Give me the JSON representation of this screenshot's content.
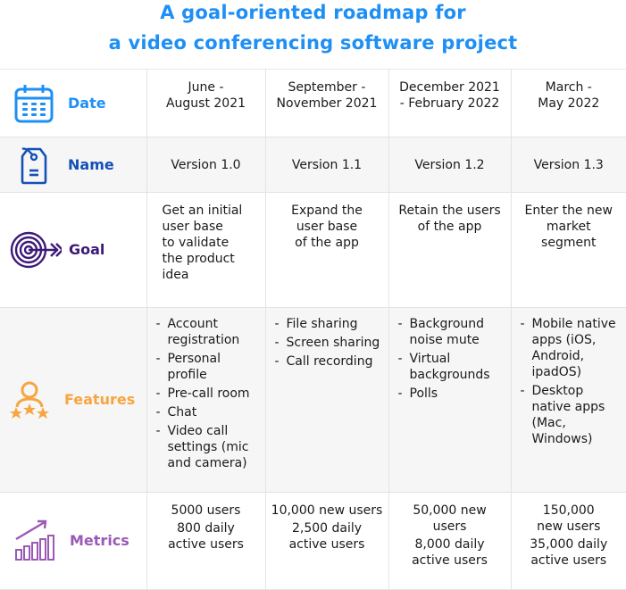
{
  "title": {
    "line1": "A goal-oriented roadmap for",
    "line2": "a video conferencing software project"
  },
  "colors": {
    "title": "#1e8ff5",
    "date": "#1e8ff5",
    "name": "#1450b8",
    "goal": "#3d1a78",
    "features": "#f7a541",
    "metrics": "#9b59b6"
  },
  "rows": {
    "date": {
      "label": "Date",
      "icon": "calendar-icon",
      "cells": [
        [
          "June -",
          "August 2021"
        ],
        [
          "September -",
          "November 2021"
        ],
        [
          "December 2021",
          "- February 2022"
        ],
        [
          "March -",
          "May 2022"
        ]
      ]
    },
    "name": {
      "label": "Name",
      "icon": "tag-icon",
      "cells": [
        "Version 1.0",
        "Version 1.1",
        "Version 1.2",
        "Version 1.3"
      ]
    },
    "goal": {
      "label": "Goal",
      "icon": "target-icon",
      "cells": [
        [
          "Get an initial",
          "user base",
          "to validate",
          "the product",
          "idea"
        ],
        [
          "Expand the",
          "user base",
          "of the app"
        ],
        [
          "Retain the users",
          "of the app"
        ],
        [
          "Enter the new",
          "market",
          "segment"
        ]
      ]
    },
    "features": {
      "label": "Features",
      "icon": "user-stars-icon",
      "cells": [
        [
          "Account registration",
          "Personal profile",
          "Pre-call room",
          "Chat",
          "Video call settings (mic and camera)"
        ],
        [
          "File sharing",
          "Screen sharing",
          "Call recording"
        ],
        [
          "Background noise mute",
          "Virtual backgrounds",
          "Polls"
        ],
        [
          "Mobile native apps (iOS, Android, ipadOS)",
          "Desktop native apps (Mac, Windows)"
        ]
      ]
    },
    "metrics": {
      "label": "Metrics",
      "icon": "growth-chart-icon",
      "cells": [
        [
          "5000 users",
          "800 daily active users"
        ],
        [
          "10,000 new users",
          "2,500 daily active users"
        ],
        [
          "50,000 new users",
          "8,000 daily active users"
        ],
        [
          "150,000 new users",
          "35,000 daily active users"
        ]
      ]
    }
  }
}
